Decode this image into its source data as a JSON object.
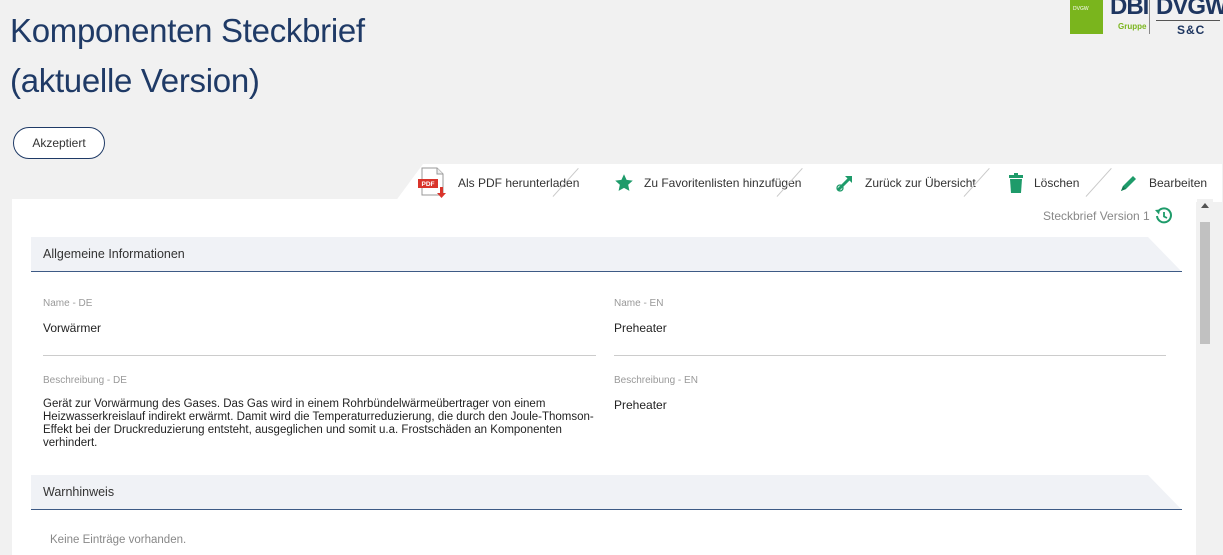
{
  "page": {
    "title_line1": "Komponenten Steckbrief",
    "title_line2": "(aktuelle Version)"
  },
  "logo": {
    "badge": "DVGW",
    "dbi": "DBI",
    "gruppe": "Gruppe",
    "dvgw": "DVGW",
    "sc": "S&C"
  },
  "status": {
    "label": "Akzeptiert"
  },
  "toolbar": {
    "pdf_label": "Als PDF herunterladen",
    "favorites_label": "Zu Favoritenlisten hinzufügen",
    "back_label": "Zurück zur Übersicht",
    "delete_label": "Löschen",
    "edit_label": "Bearbeiten",
    "pdf_icon_text": "PDF"
  },
  "version": {
    "label": "Steckbrief Version 1"
  },
  "general": {
    "heading": "Allgemeine Informationen",
    "name_de_label": "Name - DE",
    "name_de_value": "Vorwärmer",
    "name_en_label": "Name - EN",
    "name_en_value": "Preheater",
    "desc_de_label": "Beschreibung - DE",
    "desc_de_value": "Gerät zur Vorwärmung des Gases. Das Gas wird in einem Rohrbündelwärmeübertrager von einem Heizwasserkreislauf indirekt erwärmt. Damit wird die Temperaturreduzierung, die durch den Joule-Thomson-Effekt bei der Druckreduzierung entsteht, ausgeglichen und somit u.a. Frostschäden an Komponenten verhindert.",
    "desc_en_label": "Beschreibung - EN",
    "desc_en_value": "Preheater"
  },
  "warning": {
    "heading": "Warnhinweis",
    "empty_text": "Keine Einträge vorhanden."
  },
  "colors": {
    "title": "#1f3a66",
    "accent_green": "#1e9b6a",
    "header_line": "#3d5a85",
    "logo_green": "#7ab51d"
  }
}
